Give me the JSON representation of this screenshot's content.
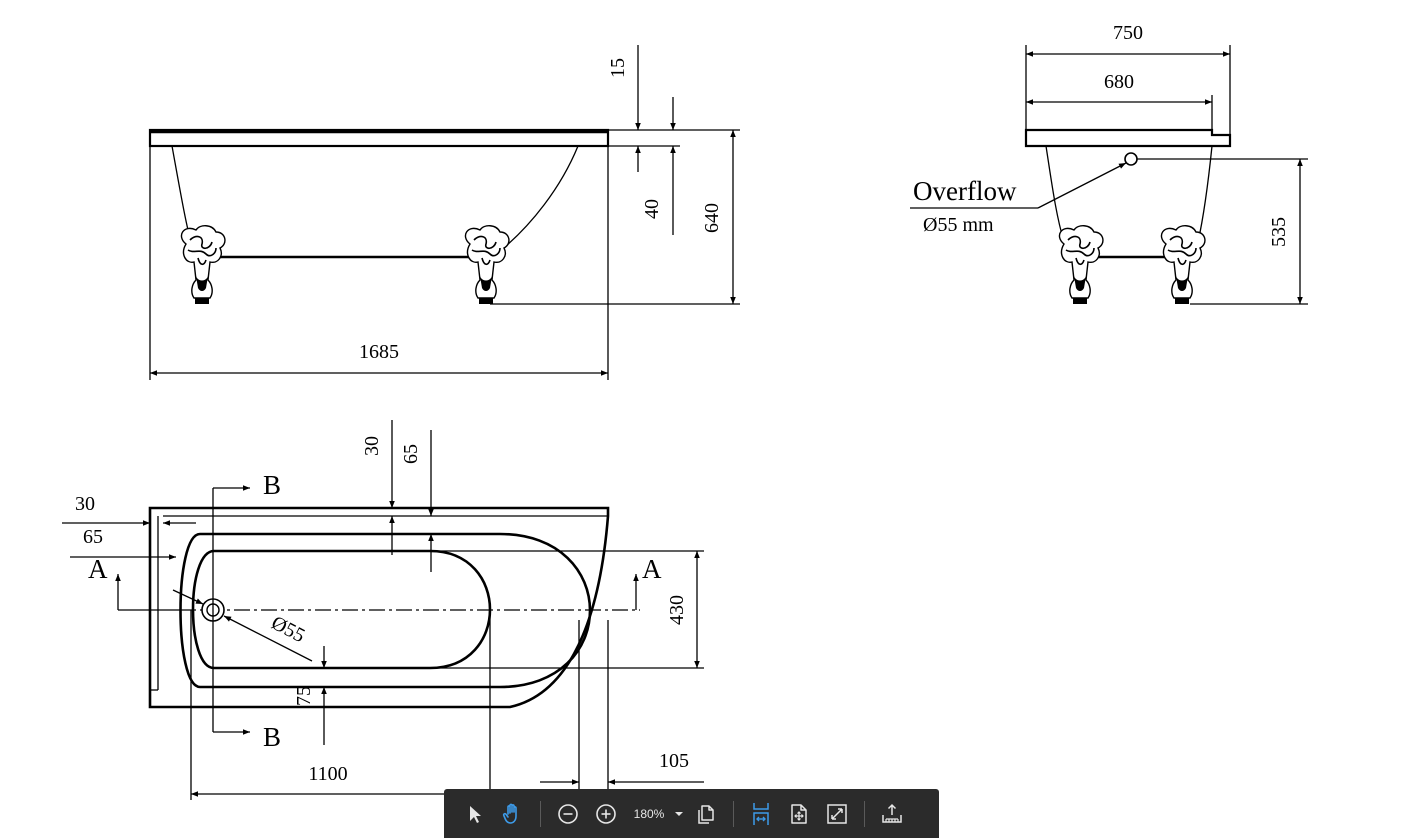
{
  "drawing": {
    "side_view": {
      "length": "1685",
      "height": "640",
      "rim_top": "15",
      "rim_thickness": "40"
    },
    "end_view": {
      "width_outer": "750",
      "width_inner": "680",
      "overflow_height": "535",
      "overflow_label": "Overflow",
      "overflow_size": "Ø55  mm"
    },
    "plan_view": {
      "section_a": "A",
      "section_b": "B",
      "rim_side_outer": "30",
      "rim_side_inner": "65",
      "rim_top_outer": "30",
      "rim_top_inner": "65",
      "drain_diameter": "Ø55",
      "drain_offset": "75",
      "basin_width": "430",
      "basin_length": "1100",
      "end_offset": "105"
    }
  },
  "toolbar": {
    "zoom_label": "180%",
    "icons": {
      "select": "cursor-arrow-icon",
      "pan": "hand-icon",
      "zoom_out": "zoom-out-icon",
      "zoom_in": "zoom-in-icon",
      "page_view": "copy-pages-icon",
      "fit_width": "fit-width-icon",
      "fit_page": "fit-page-icon",
      "fullscreen": "fullscreen-icon",
      "export": "export-icon"
    },
    "colors": {
      "background": "#2b2b2b",
      "icon": "#e6e6e6",
      "active": "#3d9be9"
    }
  }
}
